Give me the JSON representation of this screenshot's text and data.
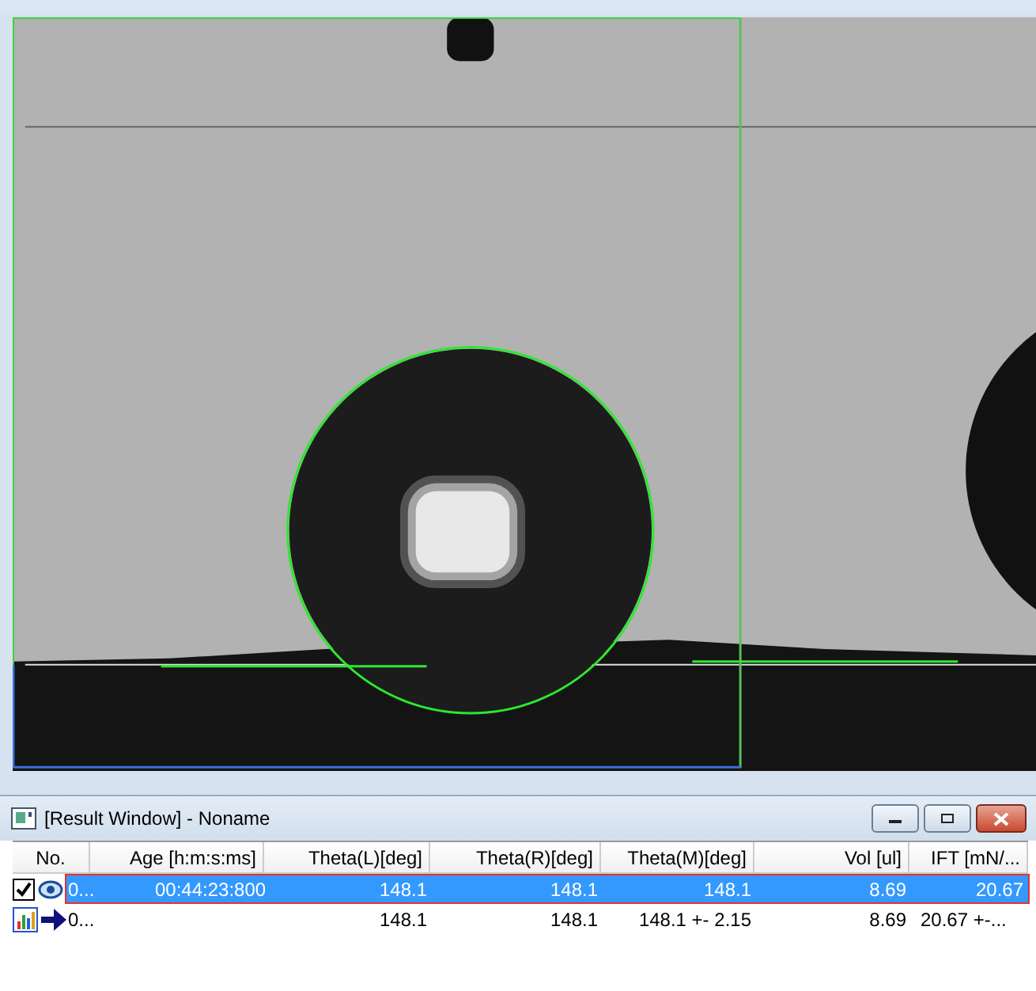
{
  "result_window": {
    "title": "[Result Window] - Noname",
    "columns": [
      "No.",
      "Age [h:m:s:ms]",
      "Theta(L)[deg]",
      "Theta(R)[deg]",
      "Theta(M)[deg]",
      "Vol [ul]",
      "IFT [mN/..."
    ],
    "rows": [
      {
        "kind": "measurement",
        "checked": true,
        "selected": true,
        "cells": {
          "no": "0...",
          "age": "00:44:23:800",
          "theta_l": "148.1",
          "theta_r": "148.1",
          "theta_m": "148.1",
          "vol": "8.69",
          "ift": "20.67"
        }
      },
      {
        "kind": "statistics",
        "selected": false,
        "cells": {
          "no": "0...",
          "theta_l": "148.1",
          "theta_r": "148.1",
          "theta_m": "148.1 +- 2.15",
          "vol": "8.69",
          "ift": "20.67 +-..."
        }
      }
    ]
  }
}
